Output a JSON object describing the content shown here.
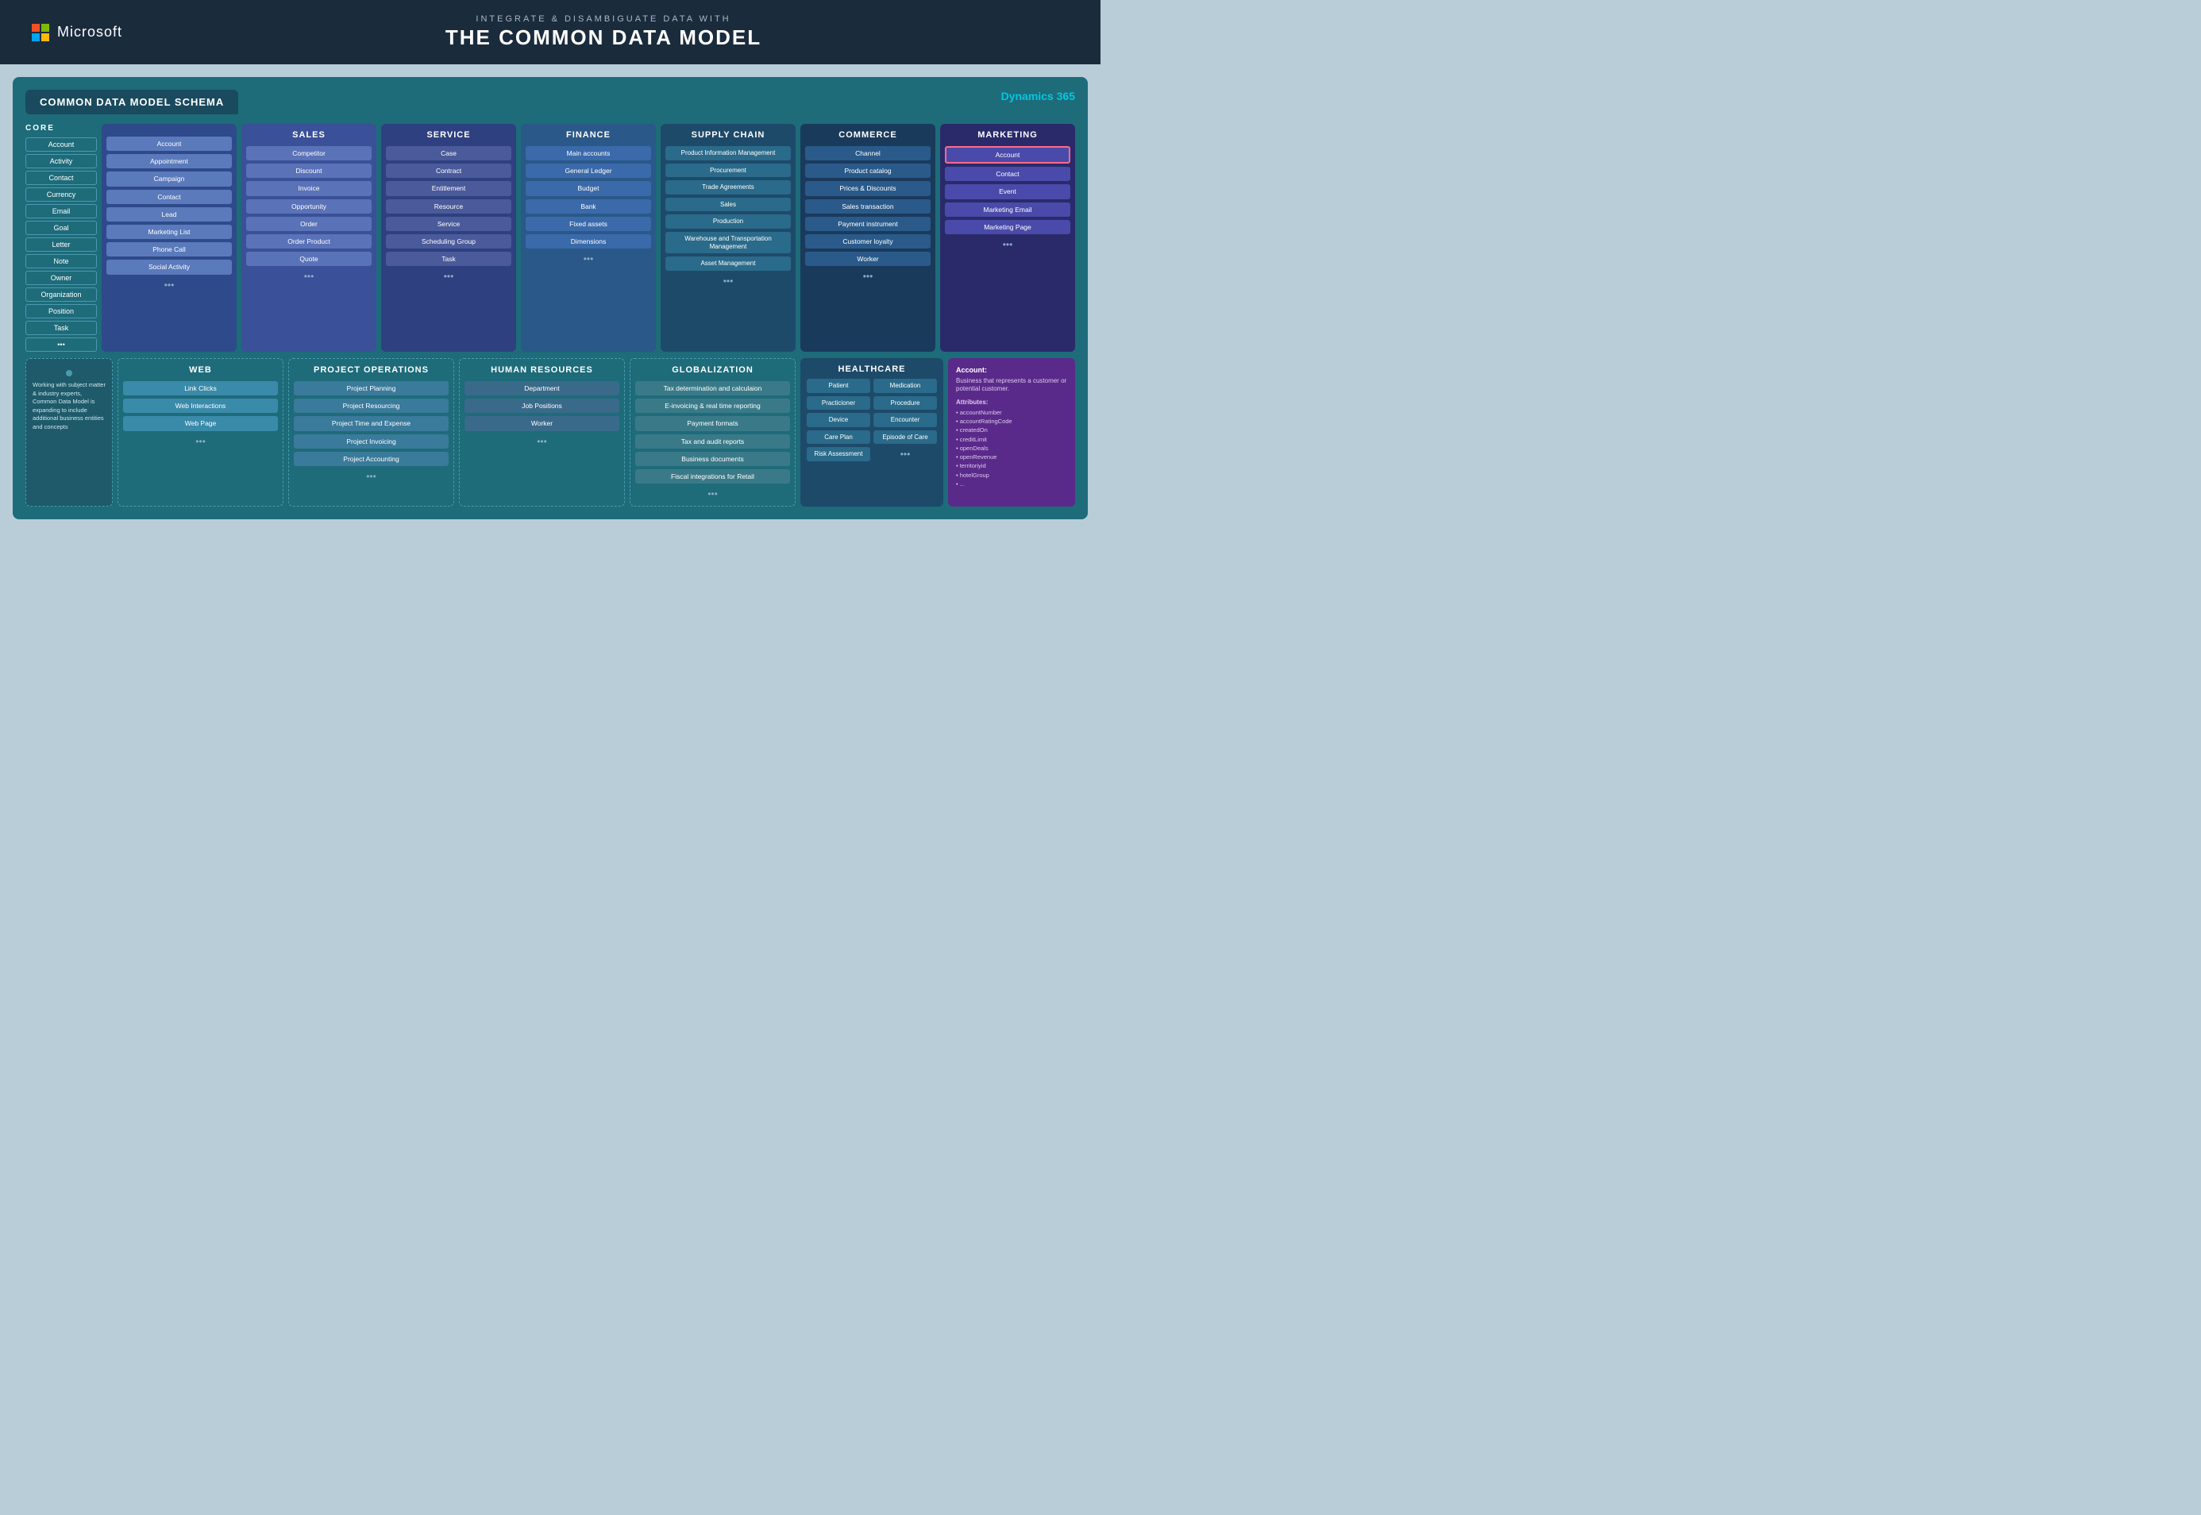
{
  "header": {
    "brand": "Microsoft",
    "subtitle": "INTEGRATE & DISAMBIGUATE DATA WITH",
    "main_title": "THE COMMON DATA MODEL"
  },
  "schema": {
    "title": "COMMON DATA MODEL SCHEMA",
    "dynamics_label": "Dynamics 365"
  },
  "core": {
    "label": "CORE",
    "items": [
      "Account",
      "Activity",
      "Contact",
      "Currency",
      "Email",
      "Goal",
      "Letter",
      "Note",
      "Owner",
      "Organization",
      "Position",
      "Task",
      "..."
    ]
  },
  "columns": {
    "common": {
      "items": [
        "Account",
        "Appointment",
        "Campaign",
        "Contact",
        "Lead",
        "Marketing List",
        "Phone Call",
        "Social Activity"
      ]
    },
    "sales": {
      "header": "SALES",
      "items": [
        "Competitor",
        "Discount",
        "Invoice",
        "Opportunity",
        "Order",
        "Order Product",
        "Quote"
      ]
    },
    "service": {
      "header": "SERVICE",
      "items": [
        "Case",
        "Contract",
        "Entitlement",
        "Resource",
        "Service",
        "Scheduling Group",
        "Task"
      ]
    },
    "finance": {
      "header": "FINANCE",
      "items": [
        "Main accounts",
        "General Ledger",
        "Budget",
        "Bank",
        "Fixed assets",
        "Dimensions"
      ]
    },
    "supply_chain": {
      "header": "SUPPLY CHAIN",
      "items": [
        "Product Information Management",
        "Procurement",
        "Trade Agreements",
        "Sales",
        "Production",
        "Warehouse and Transportation Management",
        "Asset Management"
      ]
    },
    "commerce": {
      "header": "COMMERCE",
      "items": [
        "Channel",
        "Product catalog",
        "Prices & Discounts",
        "Sales transaction",
        "Payment instrument",
        "Customer loyalty",
        "Worker"
      ]
    },
    "marketing": {
      "header": "MARKETING",
      "items": [
        "Account",
        "Contact",
        "Event",
        "Marketing Email",
        "Marketing Page"
      ]
    }
  },
  "bottom": {
    "web": {
      "header": "WEB",
      "items": [
        "Link Clicks",
        "Web Interactions",
        "Web Page"
      ]
    },
    "project_ops": {
      "header": "PROJECT OPERATIONS",
      "items": [
        "Project Planning",
        "Project Resourcing",
        "Project Time and Expense",
        "Project Invoicing",
        "Project Accounting"
      ]
    },
    "human_resources": {
      "header": "HUMAN RESOURCES",
      "items": [
        "Department",
        "Job Positions",
        "Worker"
      ]
    },
    "globalization": {
      "header": "GLOBALIZATION",
      "items": [
        "Tax determination and calculaion",
        "E-invoicing & real time reporting",
        "Payment formats",
        "Tax and audit reports",
        "Business documents",
        "Fiscal integrations for Retail"
      ]
    },
    "healthcare": {
      "header": "HEALTHCARE",
      "items": [
        "Patient",
        "Medication",
        "Practicioner",
        "Procedure",
        "Device",
        "Encounter",
        "Care Plan",
        "Episode of Care",
        "Risk Assessment"
      ]
    }
  },
  "expanding_text": "Working with subject matter & industry experts, Common Data Model is expanding to include additional business entities and concepts",
  "account_tooltip": {
    "title": "Account:",
    "description": "Business that represents a customer or potential customer.",
    "attributes_label": "Attributes:",
    "attributes": [
      "accountNumber",
      "accountRatingCode",
      "createdOn",
      "creditLimit",
      "openDeals",
      "openRevenue",
      "territoriyid",
      "hotelGroup",
      "..."
    ]
  }
}
